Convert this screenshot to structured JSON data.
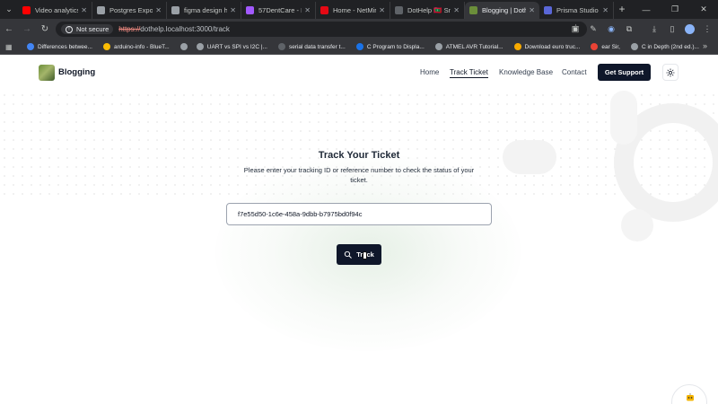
{
  "browser": {
    "tabs": [
      {
        "title": "Video analytics",
        "color": "#ff0000",
        "active": false
      },
      {
        "title": "Postgres Export",
        "color": "#9aa0a6",
        "active": false
      },
      {
        "title": "figma design ha",
        "color": "#9aa0a6",
        "active": false
      },
      {
        "title": "57DentCare - Dr",
        "color": "#a259ff",
        "active": false
      },
      {
        "title": "Home - NetMirr",
        "color": "#e50914",
        "active": false
      },
      {
        "title": "DotHelp 🇲🇻 Sna",
        "color": "#5f6368",
        "active": false
      },
      {
        "title": "Blogging | Doth",
        "color": "#6b8e3a",
        "active": true
      },
      {
        "title": "Prisma Studio",
        "color": "#5a67d8",
        "active": false
      }
    ],
    "security_label": "Not secure",
    "url_scheme": "https://",
    "url_rest": "dothelp.localhost:3000/track",
    "bookmarks": [
      {
        "label": "Differences betwee...",
        "color": "#4285f4"
      },
      {
        "label": "arduino-info - BlueT...",
        "color": "#fbbc04"
      },
      {
        "label": "",
        "color": "#9aa0a6"
      },
      {
        "label": "UART vs SPI vs I2C |...",
        "color": "#9aa0a6"
      },
      {
        "label": "serial data transfer t...",
        "color": "#5f6368"
      },
      {
        "label": "C Program to Displa...",
        "color": "#1a73e8"
      },
      {
        "label": "ATMEL AVR Tutorial...",
        "color": "#9aa0a6"
      },
      {
        "label": "Download euro truc...",
        "color": "#f9ab00"
      },
      {
        "label": "ear Sir,",
        "color": "#ea4335"
      },
      {
        "label": "C in Depth (2nd ed.)...",
        "color": "#9aa0a6"
      }
    ]
  },
  "site": {
    "brand": "Blogging",
    "nav": {
      "home": "Home",
      "track": "Track Ticket",
      "kb": "Knowledge Base",
      "contact": "Contact"
    },
    "support_label": "Get Support"
  },
  "main": {
    "title": "Track Your Ticket",
    "description": "Please enter your tracking ID or reference number to check the status of your ticket.",
    "ticket_value": "f7e55d50-1c6e-458a-9dbb-b7975bd0f94c",
    "track_label": "Track"
  },
  "colors": {
    "primary": "#0f172a",
    "browser_dark": "#202124",
    "browser_toolbar": "#35363a"
  }
}
